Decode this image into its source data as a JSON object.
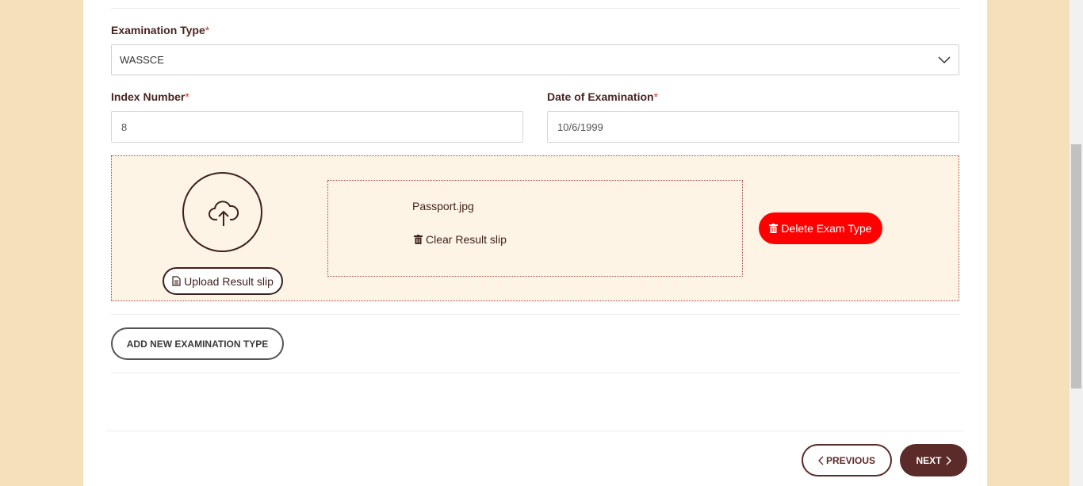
{
  "exam_type": {
    "label": "Examination Type",
    "required_mark": "*",
    "value": "WASSCE"
  },
  "index_number": {
    "label": "Index Number",
    "required_mark": "*",
    "value": "8"
  },
  "date_of_exam": {
    "label": "Date of Examination",
    "required_mark": "*",
    "value": "10/6/1999"
  },
  "upload": {
    "upload_button": "Upload Result slip",
    "file_name": "Passport.jpg",
    "clear_button": "Clear Result slip",
    "delete_button": "Delete Exam Type"
  },
  "add_button": "ADD NEW EXAMINATION TYPE",
  "nav": {
    "previous": "PREVIOUS",
    "next": "NEXT"
  },
  "colors": {
    "brand": "#5a2b28",
    "danger": "#ff0000",
    "page_bg": "#f4e1b9",
    "panel_bg": "#fdf4e6"
  }
}
